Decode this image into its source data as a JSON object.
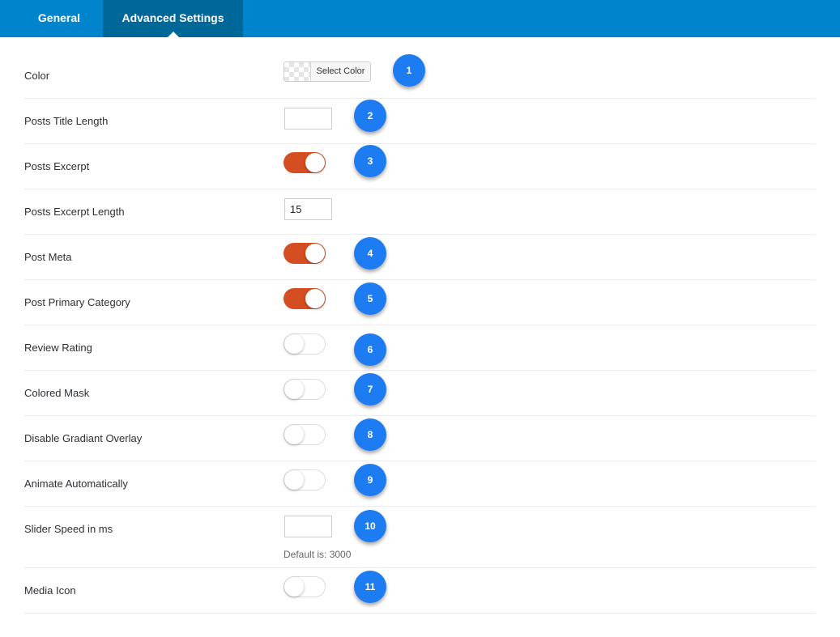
{
  "tabs": [
    {
      "label": "General",
      "active": false
    },
    {
      "label": "Advanced Settings",
      "active": true
    }
  ],
  "color": {
    "label": "Color",
    "button_label": "Select Color"
  },
  "posts_title_length": {
    "label": "Posts Title Length",
    "value": ""
  },
  "posts_excerpt": {
    "label": "Posts Excerpt",
    "enabled": true
  },
  "posts_excerpt_length": {
    "label": "Posts Excerpt Length",
    "value": "15"
  },
  "post_meta": {
    "label": "Post Meta",
    "enabled": true
  },
  "post_primary_category": {
    "label": "Post Primary Category",
    "enabled": true
  },
  "review_rating": {
    "label": "Review Rating",
    "enabled": false
  },
  "colored_mask": {
    "label": "Colored Mask",
    "enabled": false
  },
  "disable_gradiant_overlay": {
    "label": "Disable Gradiant Overlay",
    "enabled": false
  },
  "animate_automatically": {
    "label": "Animate Automatically",
    "enabled": false
  },
  "slider_speed": {
    "label": "Slider Speed in ms",
    "value": "",
    "hint": "Default is: 3000"
  },
  "media_icon": {
    "label": "Media Icon",
    "enabled": false
  },
  "badges": [
    "1",
    "2",
    "3",
    "4",
    "5",
    "6",
    "7",
    "8",
    "9",
    "10",
    "11"
  ],
  "colors": {
    "header": "#0085cc",
    "active_tab": "#006799",
    "toggle_on": "#d54e21",
    "badge": "#1e7cf2"
  }
}
